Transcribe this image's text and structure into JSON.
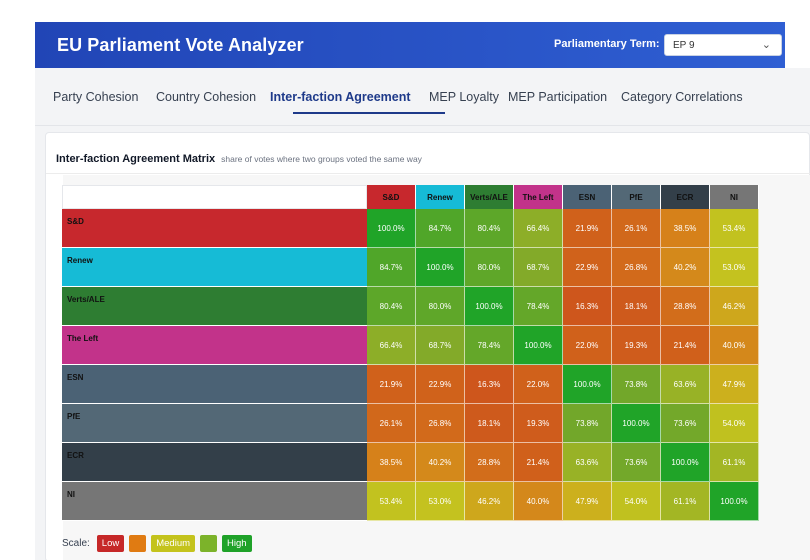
{
  "header": {
    "title": "EU Parliament Vote Analyzer",
    "term_label": "Parliamentary Term:",
    "term_value": "EP 9"
  },
  "tabs": [
    {
      "label": "Party Cohesion",
      "active": false
    },
    {
      "label": "Country Cohesion",
      "active": false
    },
    {
      "label": "Inter-faction Agreement",
      "active": true
    },
    {
      "label": "MEP Loyalty",
      "active": false
    },
    {
      "label": "MEP Participation",
      "active": false
    },
    {
      "label": "Category Correlations",
      "active": false
    }
  ],
  "card": {
    "title": "Inter-faction Agreement Matrix",
    "subtitle": "share of votes where two groups voted the same way"
  },
  "matrix": {
    "groups": [
      "S&D",
      "Renew",
      "Verts/ALE",
      "The Left",
      "ESN",
      "PfE",
      "ECR",
      "NI"
    ],
    "group_colors": [
      "#c7282d",
      "#16bbd6",
      "#2e7d32",
      "#c2338a",
      "#4b6275",
      "#536876",
      "#333f49",
      "#767676"
    ],
    "values": [
      [
        "100.0%",
        "84.7%",
        "80.4%",
        "66.4%",
        "21.9%",
        "26.1%",
        "38.5%",
        "53.4%"
      ],
      [
        "84.7%",
        "100.0%",
        "80.0%",
        "68.7%",
        "22.9%",
        "26.8%",
        "40.2%",
        "53.0%"
      ],
      [
        "80.4%",
        "80.0%",
        "100.0%",
        "78.4%",
        "16.3%",
        "18.1%",
        "28.8%",
        "46.2%"
      ],
      [
        "66.4%",
        "68.7%",
        "78.4%",
        "100.0%",
        "22.0%",
        "19.3%",
        "21.4%",
        "40.0%"
      ],
      [
        "21.9%",
        "22.9%",
        "16.3%",
        "22.0%",
        "100.0%",
        "73.8%",
        "63.6%",
        "47.9%"
      ],
      [
        "26.1%",
        "26.8%",
        "18.1%",
        "19.3%",
        "73.8%",
        "100.0%",
        "73.6%",
        "54.0%"
      ],
      [
        "38.5%",
        "40.2%",
        "28.8%",
        "21.4%",
        "63.6%",
        "73.6%",
        "100.0%",
        "61.1%"
      ],
      [
        "53.4%",
        "53.0%",
        "46.2%",
        "40.0%",
        "47.9%",
        "54.0%",
        "61.1%",
        "100.0%"
      ]
    ]
  },
  "scale": {
    "label": "Scale:",
    "chips": [
      {
        "text": "Low",
        "color": "#c62828"
      },
      {
        "text": "",
        "color": "#e07b12"
      },
      {
        "text": "Medium",
        "color": "#c4c31c"
      },
      {
        "text": "",
        "color": "#7cb32a"
      },
      {
        "text": "High",
        "color": "#1fa229"
      }
    ]
  }
}
